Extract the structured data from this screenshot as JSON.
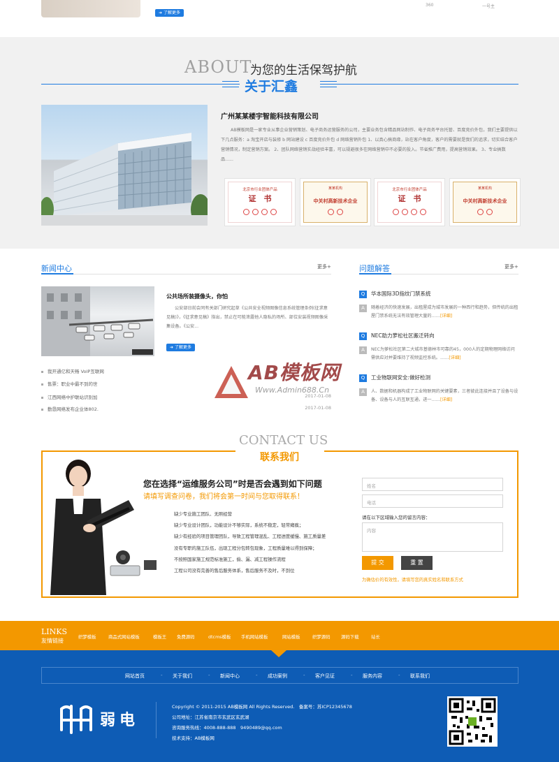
{
  "top": {
    "more_label": "了解更多",
    "stat_a": "360",
    "stat_b": "一号主"
  },
  "about": {
    "title_en": "ABOUT",
    "title_cn": "为您的生活保驾护航",
    "subtitle": "关于汇鑫",
    "company": "广州某某楼宇智能科技有限公司",
    "description": "AB模板网是一家专业从事企业营销策划、电子商务运营服务的公司，主要业务包含精品网站制作、电子商务平台托管、百度竞价外包，我们主要提供以下几点服务：a 淘宝开店与装修 b 网站建设 c 百度竞价外包 d 网络营销外包 1、以真心搞商缘，站在客户角度，客户的需要就是我们的追求，切实结合客户营销情况，制定营销方案。 2、团队网络营销实战经验丰富，可以规避很多在网络营销中不必要的投入。节省推广费用，提高营销效果。 3、专业搞数品......",
    "certs": [
      {
        "kind": "red",
        "top": "北京市行业团体产品",
        "big": "证　书"
      },
      {
        "kind": "gold",
        "top": "某某机构",
        "big": "中关村高新技术企业"
      },
      {
        "kind": "red",
        "top": "北京市行业团体产品",
        "big": "证　书"
      },
      {
        "kind": "gold",
        "top": "某某机构",
        "big": "中关村高新技术企业"
      }
    ]
  },
  "news": {
    "title": "新闻中心",
    "more": "更多+",
    "headline": "公共场所装摄像头，你怕",
    "desc": "公安部日前会同有关部门研究起草《公共安全视频图像信息系统管理条例(征求意见稿)》，《征求意见稿》指出，禁止在可能泄露他人隐私的场所、部位安装视频图像采集设备。《公安...",
    "more_label": "了解更多",
    "items": [
      {
        "title": "我开通亿和天畅 VoIP互联网",
        "date": ""
      },
      {
        "title": "售票：职业中最不到的世",
        "date": ""
      },
      {
        "title": "江西网络中护联站识别加",
        "date": "2017-01-08"
      },
      {
        "title": "勤恳网络发布企业体802.",
        "date": "2017-01-08"
      }
    ]
  },
  "qa": {
    "title": "问题解答",
    "more": "更多+",
    "detail": "[详细]",
    "items": [
      {
        "q": "华本国际3D指纹门禁系统",
        "a": "随着经济的快速发展，出租屋成为城市发展的一种西行和趋势，但传统的出租屋门禁系统无法有效管理大量的……"
      },
      {
        "q": "NEC助力萝松社区搬迁转向",
        "a": "NEC为萝松社区第二大城市基德林市可靠的45，000人的定期物理网络访问需供应对并要维持了视频监控系统。……"
      },
      {
        "q": "工业物联网安全:做好检测",
        "a": "人、数据和机器构成了工业物联网的关键要素，三者彼此连接并且了设备与设备、设备与人的互联互通，进一……"
      }
    ]
  },
  "watermark": {
    "title": "AB模板网",
    "url": "Www.Admin688.Cn"
  },
  "contact": {
    "title_en": "CONTACT US",
    "title_cn": "联系我们",
    "question": "您在选择“运维服务公司”时是否会遇到如下问题",
    "prompt": "请填写调查问卷，我们将会第一时间与您取得联系！",
    "issues": [
      "缺少专业施工团队、无照经营",
      "缺少专业设计团队，功能设计不够实际，系统不稳定，轻常瘫痪；",
      "缺少有经验的项目管理团队，导致工程管理混乱、工程进度缓慢、施工质量差",
      "没有专职的施工队伍，出现工程分包转包现象，工程质量难以得到保障；",
      "不按照国家施工规范标准施工，偷、漏、减工程操作流程",
      "工程公司没有完善的售后服务体系，售后服务不及时，不到位"
    ],
    "name_placeholder": "姓名",
    "phone_placeholder": "电话",
    "textarea_label": "请在以下区域输入您的留言内容：",
    "textarea_placeholder": "内容",
    "submit": "提 交",
    "reset": "重 置",
    "note": "为确估价的有效性，请填写您的真实姓名和联系方式"
  },
  "links": {
    "title_en": "LINKS",
    "title_cn": "友情链接",
    "items": [
      "织梦模板",
      "商品式网站模板",
      "模板王",
      "免费源码",
      "dtcms模板",
      "手机网站模板",
      "网站模板",
      "织梦源码",
      "源码下载",
      "站长"
    ]
  },
  "footer": {
    "nav": [
      "网站首页",
      "关于我们",
      "新闻中心",
      "成功案例",
      "客户见证",
      "服务内容",
      "联系我们"
    ],
    "logo_text": "弱电",
    "copyright": "Copyright © 2011-2015 AB模板网 All Rights Reserved.　备案号：苏ICP12345678",
    "address": "公司地址：江苏省南京市玄武区玄武湖",
    "hotline": "咨询服务热线：4008-888-888　9490489@qq.com",
    "support": "技术支持：AB模板网"
  },
  "colors": {
    "blue": "#1e7be0",
    "orange": "#f39800",
    "footer_blue": "#0e5cb5"
  }
}
